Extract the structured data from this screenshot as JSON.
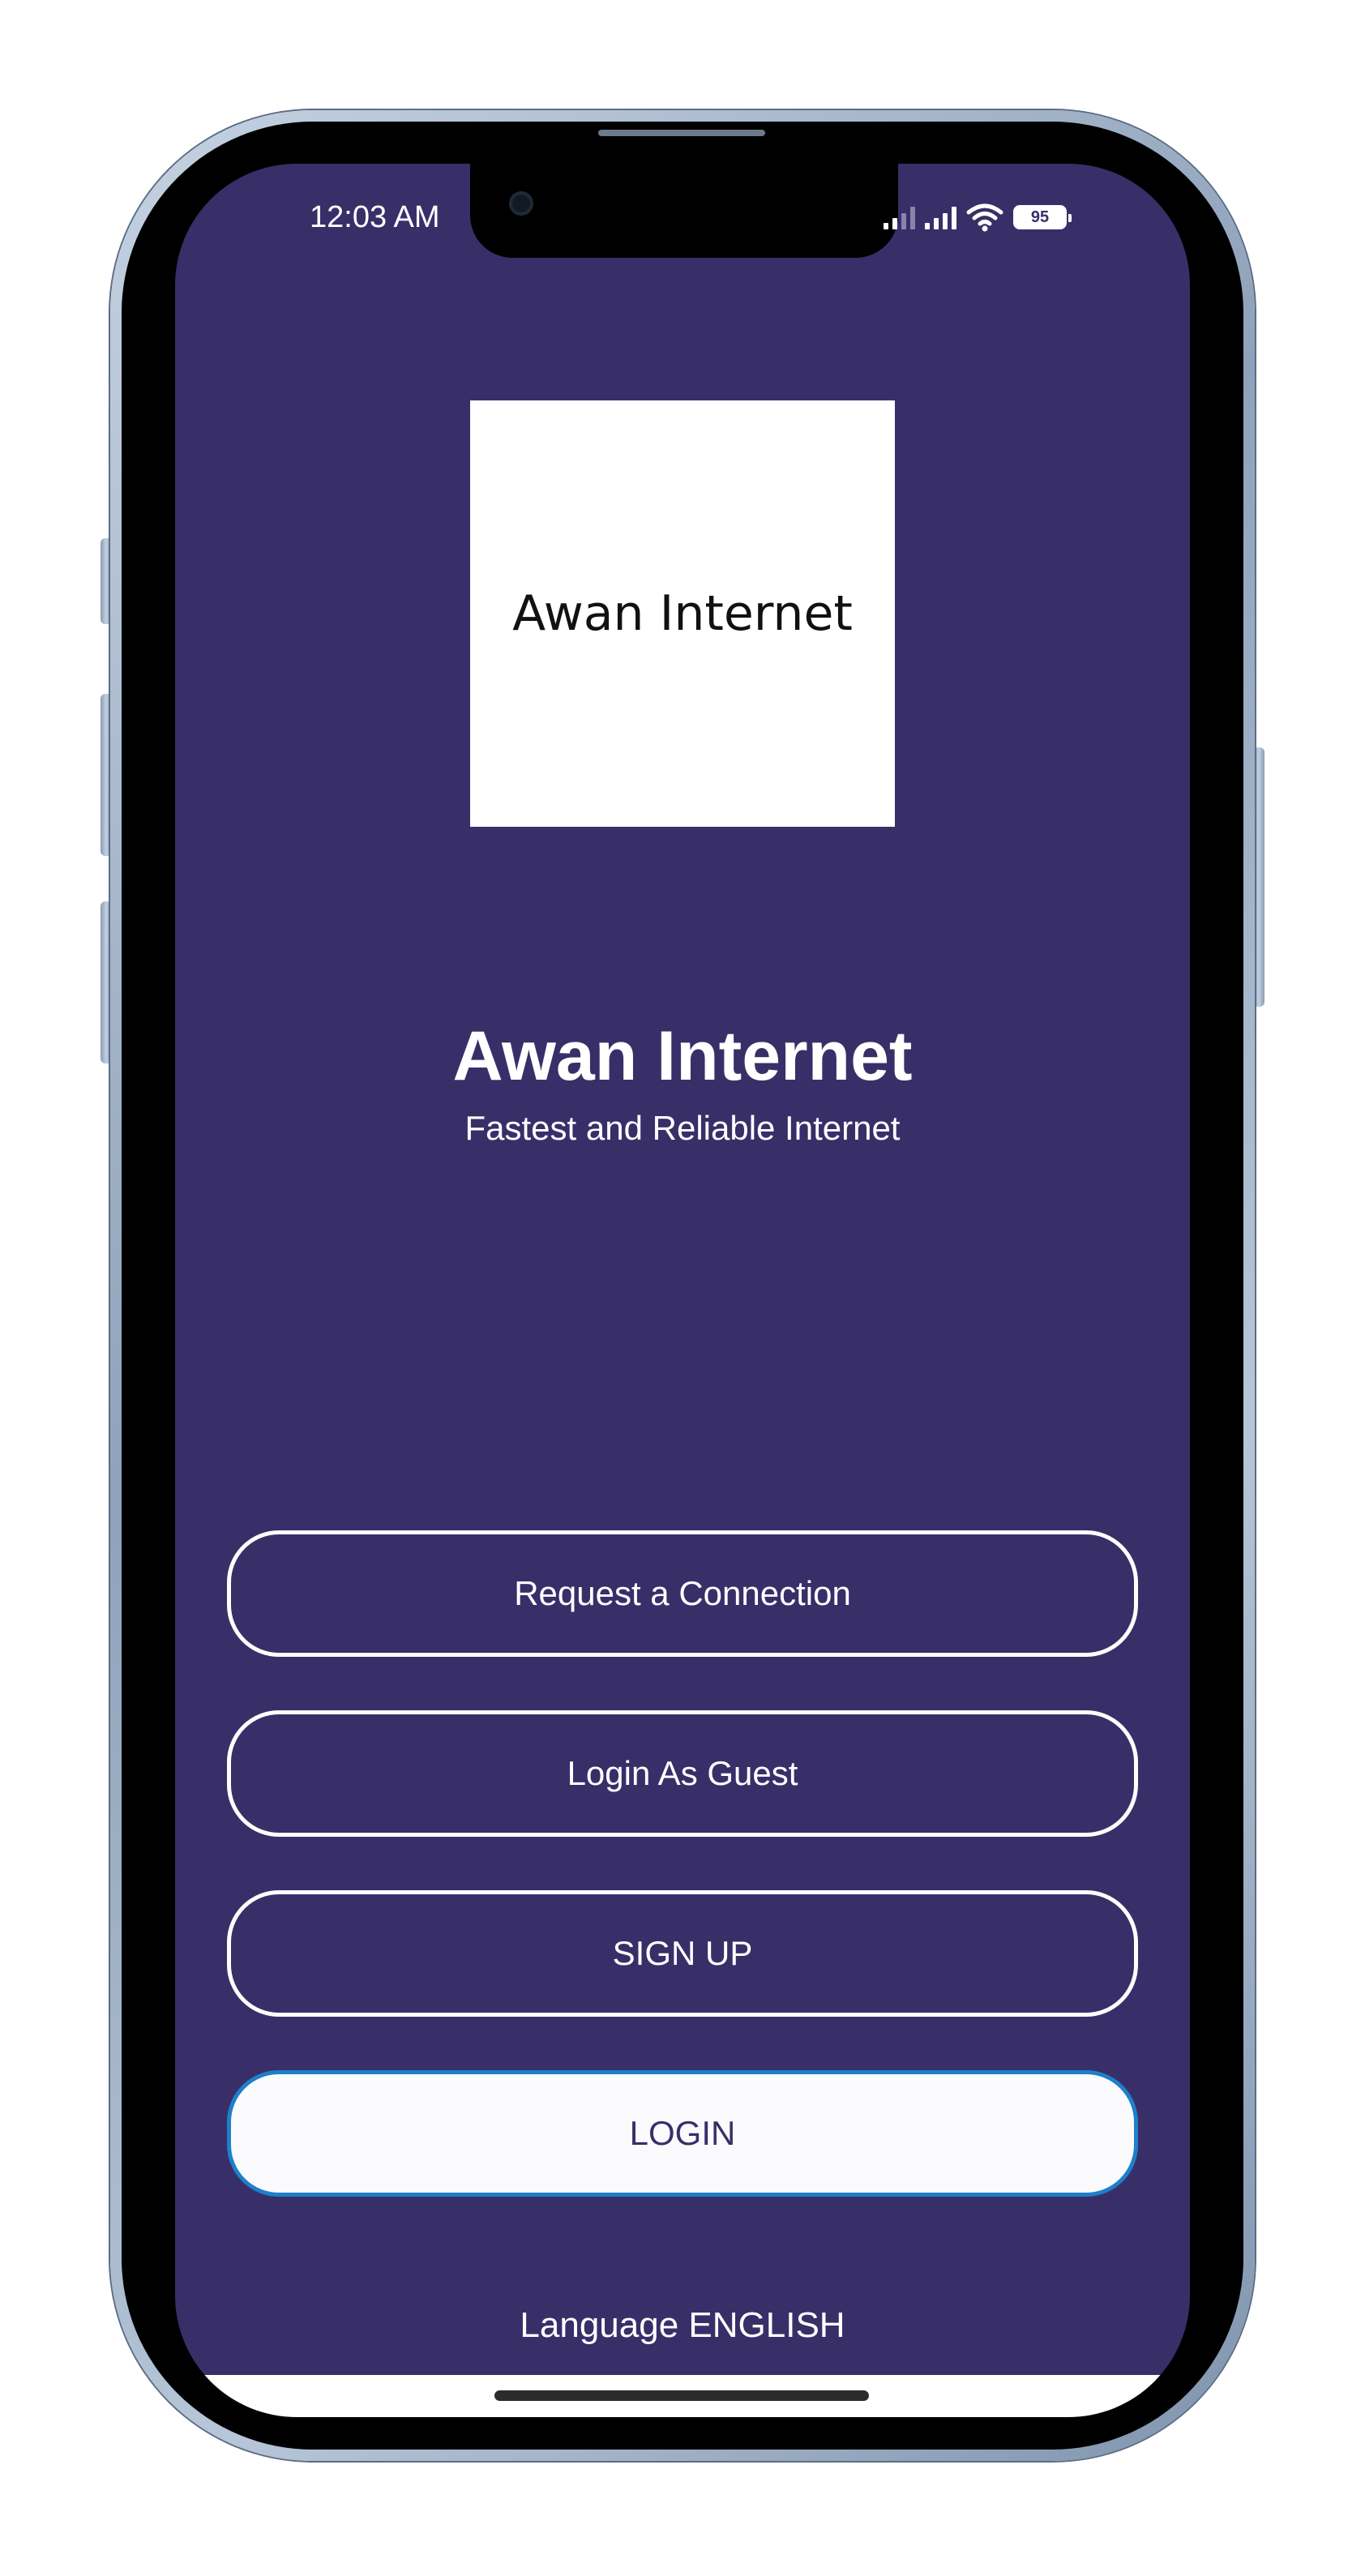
{
  "status_bar": {
    "time": "12:03 AM",
    "battery": "95"
  },
  "logo": {
    "text": "Awan Internet"
  },
  "app": {
    "title": "Awan Internet",
    "subtitle": "Fastest and Reliable Internet"
  },
  "buttons": {
    "request_connection": "Request a Connection",
    "login_guest": "Login As Guest",
    "sign_up": "SIGN UP",
    "login": "LOGIN"
  },
  "footer": {
    "language": "Language ENGLISH"
  },
  "colors": {
    "background": "#382f69",
    "button_border": "#ffffff",
    "login_focus_border": "#1f7fc9"
  }
}
